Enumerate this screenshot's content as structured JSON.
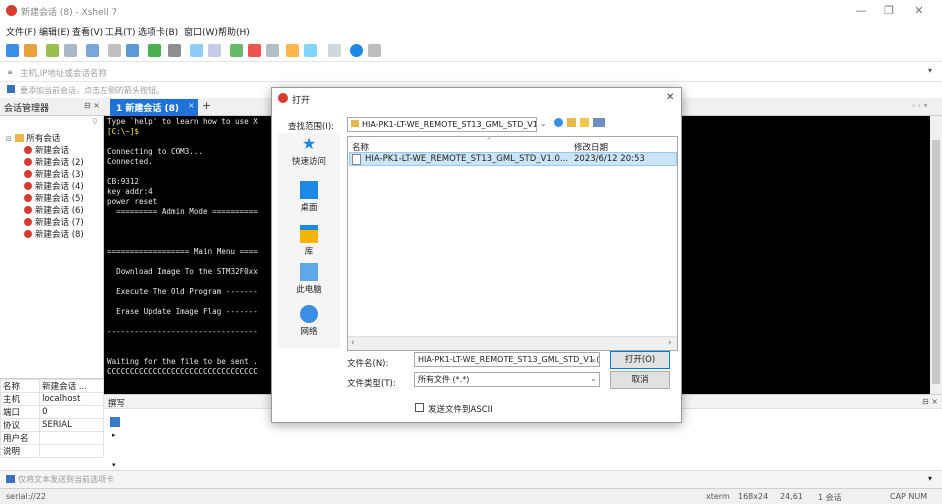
{
  "window": {
    "title": "新建会话 (8) - Xshell 7"
  },
  "menu": [
    "文件(F)",
    "编辑(E)",
    "查看(V)",
    "工具(T)",
    "选项卡(B)",
    "窗口(W)",
    "帮助(H)"
  ],
  "address_bar": {
    "placeholder": "主机,IP地址或会话名称"
  },
  "hint_bar": {
    "text": "要添加当前会话，点击左侧的箭头按钮。"
  },
  "session_manager": {
    "title": "会话管理器",
    "root": "所有会话",
    "sessions": [
      "新建会话",
      "新建会话 (2)",
      "新建会话 (3)",
      "新建会话 (4)",
      "新建会话 (5)",
      "新建会话 (6)",
      "新建会话 (7)",
      "新建会话 (8)"
    ]
  },
  "tab": {
    "label": "1 新建会话 (8)",
    "add": "+"
  },
  "terminal_lines": [
    "Type `help' to learn how to use X",
    "[C:\\~]$",
    "",
    "Connecting to COM3...",
    "Connected.",
    "",
    "CB:9312",
    "key addr:4",
    "power reset",
    "  ========= Admin Mode ==========",
    "",
    "",
    "",
    "================== Main Menu ====",
    "",
    "  Download Image To the STM32F0xx",
    "",
    "  Execute The Old Program -------",
    "",
    "  Erase Update Image Flag -------",
    "",
    "---------------------------------",
    "",
    "",
    "Waiting for the file to be sent .",
    "CCCCCCCCCCCCCCCCCCCCCCCCCCCCCCCCC"
  ],
  "properties": [
    {
      "key": "名称",
      "value": "新建会话 ..."
    },
    {
      "key": "主机",
      "value": "localhost"
    },
    {
      "key": "端口",
      "value": "0"
    },
    {
      "key": "协议",
      "value": "SERIAL"
    },
    {
      "key": "用户名",
      "value": ""
    },
    {
      "key": "说明",
      "value": ""
    }
  ],
  "compose": {
    "title": "撰写"
  },
  "send_bar": {
    "text": "仅将文本发送到当前选项卡"
  },
  "status": {
    "left": "serial://22",
    "term": "xterm",
    "size": "168x24",
    "cursor": "24,61",
    "sessions": "1 会话",
    "caps": "CAP NUM"
  },
  "dialog": {
    "title": "打开",
    "lookin_label": "查找范围(I):",
    "lookin_value": "HIA-PK1-LT-WE_REMOTE_ST13_GML_STD_V1.",
    "places": [
      "快速访问",
      "桌面",
      "库",
      "此电脑",
      "网络"
    ],
    "col_name": "名称",
    "col_date": "修改日期",
    "files": [
      {
        "name": "HIA-PK1-LT-WE_REMOTE_ST13_GML_STD_V1.0...",
        "date": "2023/6/12 20:53"
      }
    ],
    "filename_label": "文件名(N):",
    "filename_value": "HIA-PK1-LT-WE_REMOTE_ST13_GML_STD_V1.(",
    "filetype_label": "文件类型(T):",
    "filetype_value": "所有文件 (*.*)",
    "open_button": "打开(O)",
    "cancel_button": "取消",
    "ascii_label": "发送文件到ASCII",
    "ascii_checked": false
  }
}
